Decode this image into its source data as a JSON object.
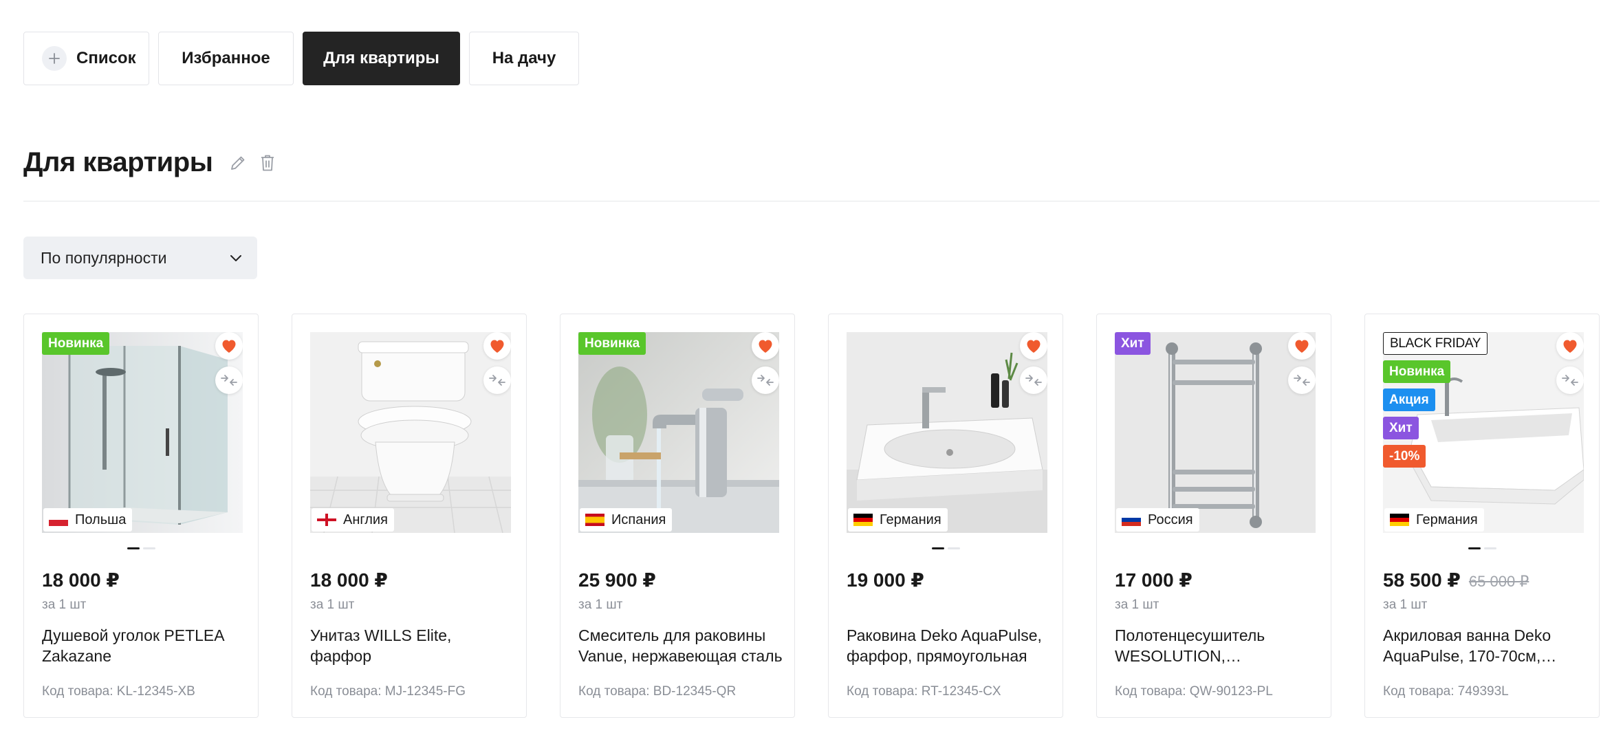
{
  "tabs": [
    {
      "label": "Список",
      "icon": "plus-icon"
    },
    {
      "label": "Избранное"
    },
    {
      "label": "Для квартиры",
      "active": true
    },
    {
      "label": "На дачу"
    }
  ],
  "page": {
    "title": "Для квартиры"
  },
  "sort": {
    "selected": "По популярности"
  },
  "colors": {
    "accent_dark": "#242424",
    "favorite": "#f05a2e",
    "badge_new": "#59c62b",
    "badge_sale": "#1c8ff0",
    "badge_hit": "#8b55e0",
    "badge_discount": "#f05a2e"
  },
  "products": [
    {
      "badges": [
        {
          "text": "Новинка",
          "kind": "new"
        }
      ],
      "country": "Польша",
      "flag": "pl",
      "price": "18 000 ₽",
      "old_price": "",
      "unit": "за 1 шт",
      "name": "Душевой уголок PETLEA Zakazane",
      "sku": "Код товара: KL-12345-XB",
      "image": "shower-cabin",
      "dots": 2,
      "active_dot": 0
    },
    {
      "badges": [],
      "country": "Англия",
      "flag": "en",
      "price": "18 000 ₽",
      "old_price": "",
      "unit": "за 1 шт",
      "name": "Унитаз WILLS Elite, фарфор",
      "sku": "Код товара: MJ-12345-FG",
      "image": "toilet",
      "dots": 0,
      "active_dot": 0
    },
    {
      "badges": [
        {
          "text": "Новинка",
          "kind": "new"
        }
      ],
      "country": "Испания",
      "flag": "es",
      "price": "25 900 ₽",
      "old_price": "",
      "unit": "за 1 шт",
      "name": "Смеситель для раковины Vanue, нержавеющая сталь",
      "sku": "Код товара: BD-12345-QR",
      "image": "faucet",
      "dots": 0,
      "active_dot": 0
    },
    {
      "badges": [],
      "country": "Германия",
      "flag": "de",
      "price": "19 000 ₽",
      "old_price": "",
      "unit": "",
      "name": "Раковина Deko AquaPulse, фарфор, прямоугольная",
      "sku": "Код товара: RT-12345-CX",
      "image": "sink",
      "dots": 2,
      "active_dot": 0
    },
    {
      "badges": [
        {
          "text": "Хит",
          "kind": "hit"
        }
      ],
      "country": "Россия",
      "flag": "ru",
      "price": "17 000 ₽",
      "old_price": "",
      "unit": "за 1 шт",
      "name": "Полотенцесушитель WESOLUTION,…",
      "sku": "Код товара: QW-90123-PL",
      "image": "towel-rail",
      "dots": 0,
      "active_dot": 0
    },
    {
      "badges": [
        {
          "text": "BLACK FRIDAY",
          "kind": "bf"
        },
        {
          "text": "Новинка",
          "kind": "new"
        },
        {
          "text": "Акция",
          "kind": "sale"
        },
        {
          "text": "Хит",
          "kind": "hit"
        },
        {
          "text": "-10%",
          "kind": "disc"
        }
      ],
      "country": "Германия",
      "flag": "de",
      "price": "58 500 ₽",
      "old_price": "65 000 ₽",
      "unit": "за 1 шт",
      "name": "Акриловая ванна Deko AquaPulse, 170-70см,…",
      "sku": "Код товара: 749393L",
      "image": "bathtub",
      "dots": 2,
      "active_dot": 0
    }
  ]
}
